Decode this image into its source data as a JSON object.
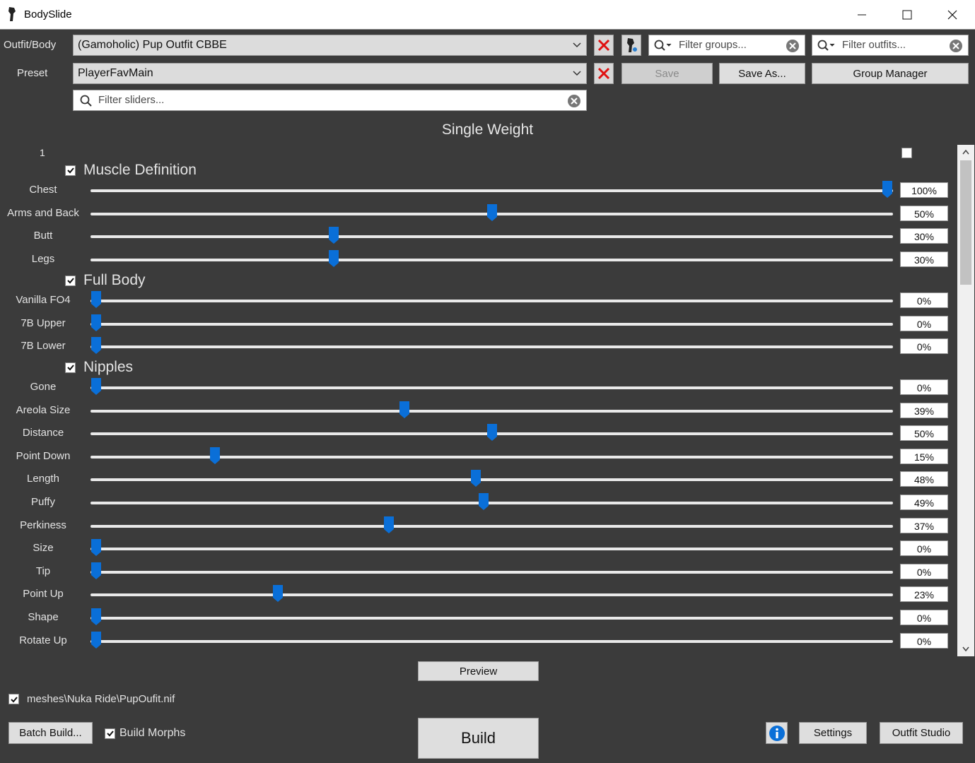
{
  "window": {
    "title": "BodySlide"
  },
  "top": {
    "outfit_label": "Outfit/Body",
    "outfit_value": "(Gamoholic) Pup Outfit CBBE",
    "preset_label": "Preset",
    "preset_value": "PlayerFavMain",
    "filter_groups_placeholder": "Filter groups...",
    "filter_outfits_placeholder": "Filter outfits...",
    "filter_sliders_placeholder": "Filter sliders...",
    "save_label": "Save",
    "save_as_label": "Save As...",
    "group_manager_label": "Group Manager"
  },
  "panel": {
    "title": "Single Weight",
    "header_number": "1"
  },
  "groups": [
    {
      "name": "Muscle Definition",
      "checked": true,
      "sliders": [
        {
          "label": "Chest",
          "value": 100,
          "display": "100%"
        },
        {
          "label": "Arms and Back",
          "value": 50,
          "display": "50%"
        },
        {
          "label": "Butt",
          "value": 30,
          "display": "30%"
        },
        {
          "label": "Legs",
          "value": 30,
          "display": "30%"
        }
      ]
    },
    {
      "name": "Full Body",
      "checked": true,
      "sliders": [
        {
          "label": "Vanilla FO4",
          "value": 0,
          "display": "0%"
        },
        {
          "label": "7B Upper",
          "value": 0,
          "display": "0%"
        },
        {
          "label": "7B Lower",
          "value": 0,
          "display": "0%"
        }
      ]
    },
    {
      "name": "Nipples",
      "checked": true,
      "sliders": [
        {
          "label": "Gone",
          "value": 0,
          "display": "0%"
        },
        {
          "label": "Areola Size",
          "value": 39,
          "display": "39%"
        },
        {
          "label": "Distance",
          "value": 50,
          "display": "50%"
        },
        {
          "label": "Point Down",
          "value": 15,
          "display": "15%"
        },
        {
          "label": "Length",
          "value": 48,
          "display": "48%"
        },
        {
          "label": "Puffy",
          "value": 49,
          "display": "49%"
        },
        {
          "label": "Perkiness",
          "value": 37,
          "display": "37%"
        },
        {
          "label": "Size",
          "value": 0,
          "display": "0%"
        },
        {
          "label": "Tip",
          "value": 0,
          "display": "0%"
        },
        {
          "label": "Point Up",
          "value": 23,
          "display": "23%"
        },
        {
          "label": "Shape",
          "value": 0,
          "display": "0%"
        },
        {
          "label": "Rotate Up",
          "value": 0,
          "display": "0%"
        }
      ]
    }
  ],
  "bottom": {
    "preview_label": "Preview",
    "file_path": "meshes\\Nuka Ride\\PupOufit.nif",
    "batch_build_label": "Batch Build...",
    "build_morphs_label": "Build Morphs",
    "build_label": "Build",
    "settings_label": "Settings",
    "outfit_studio_label": "Outfit Studio"
  },
  "colors": {
    "accent": "#0a6fd8",
    "background": "#3b3b3b",
    "delete": "#e01010"
  }
}
